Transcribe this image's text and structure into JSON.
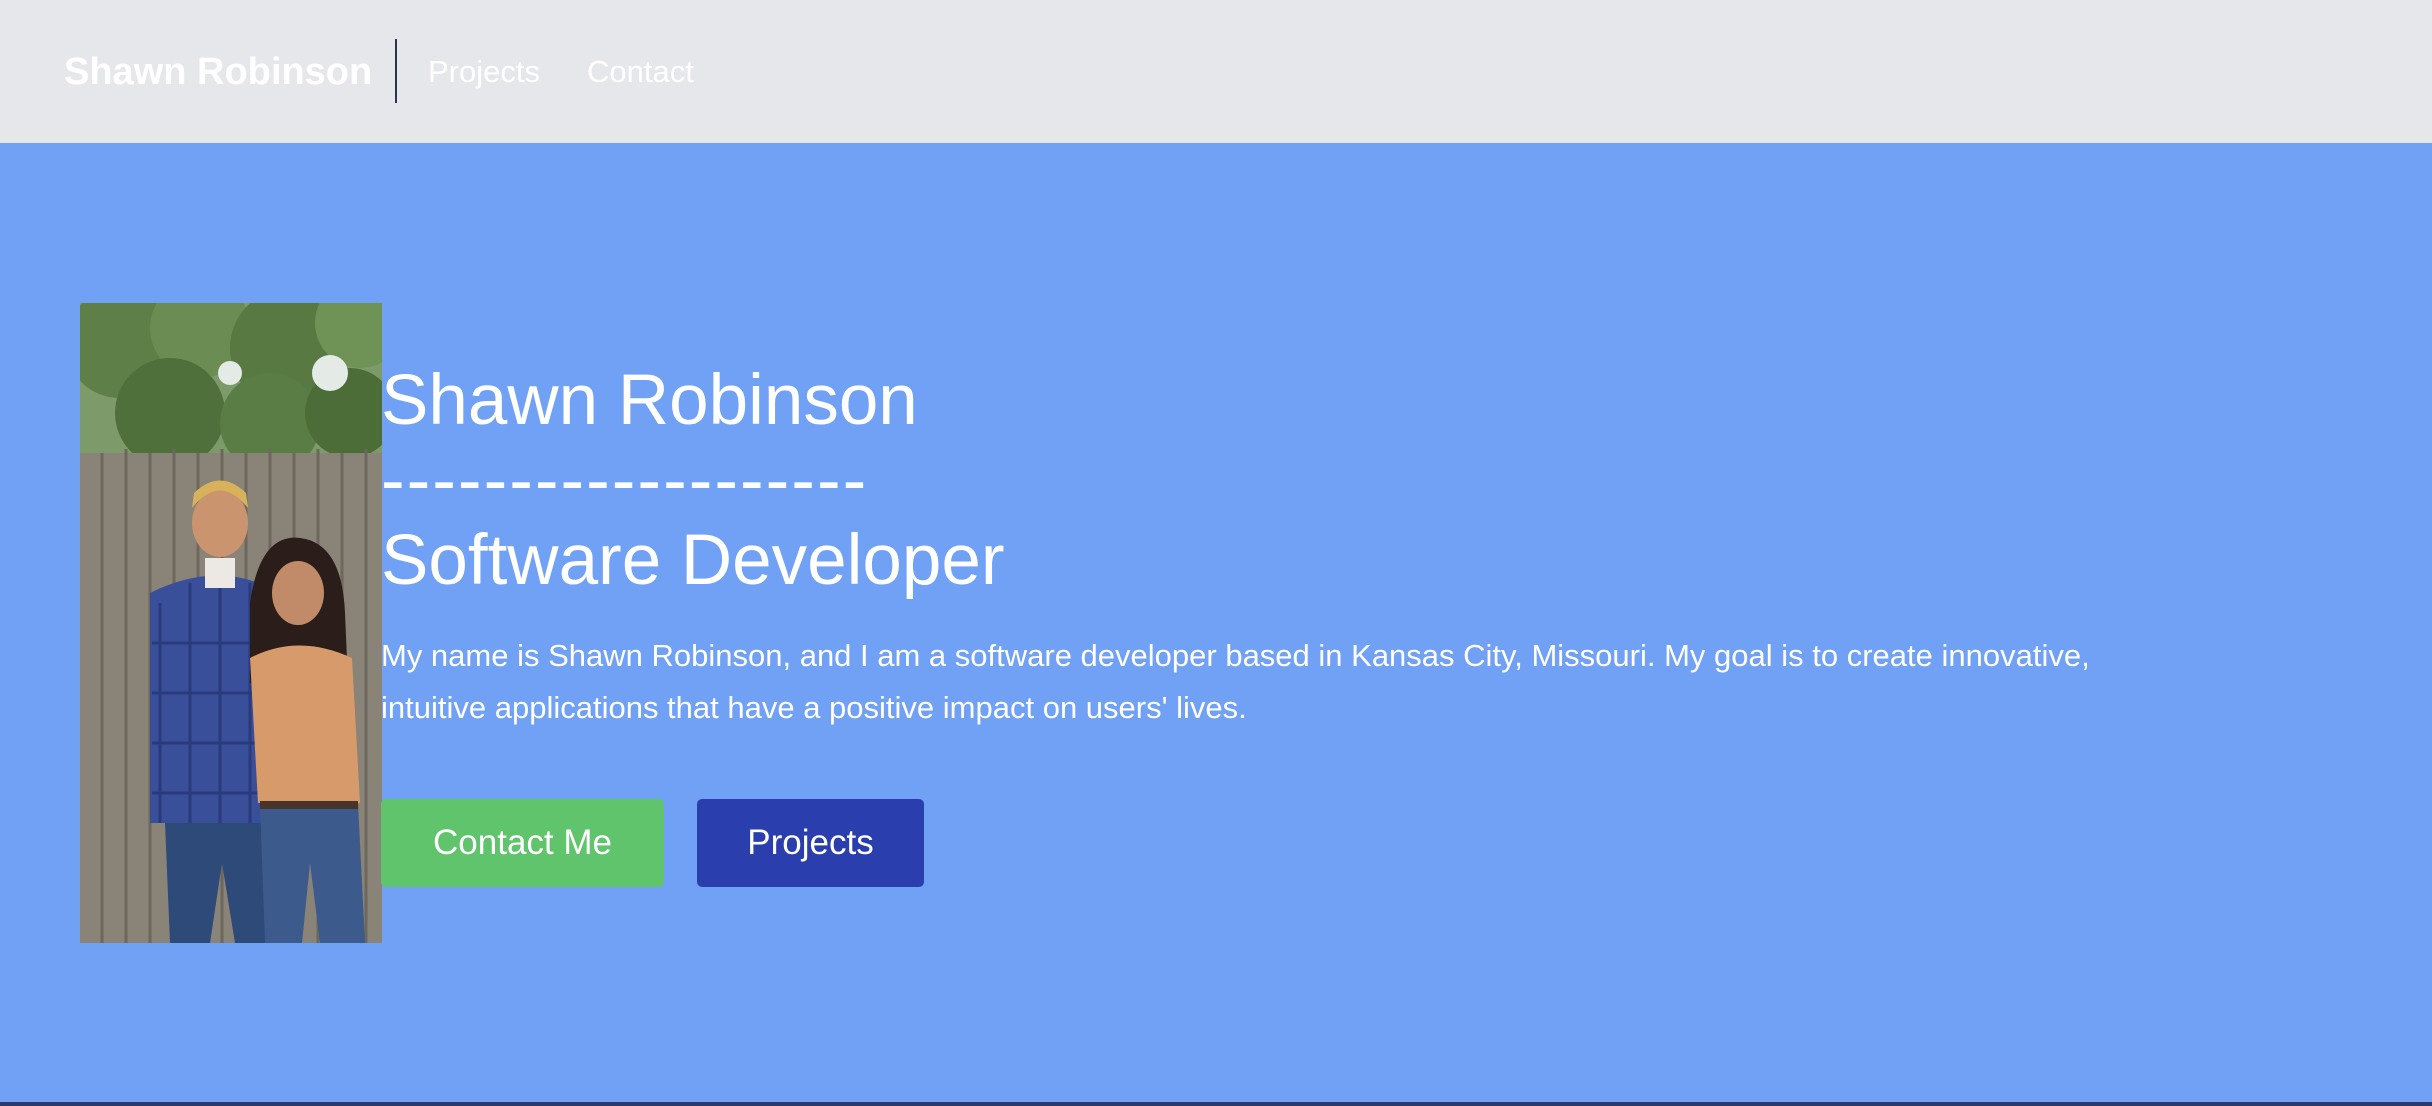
{
  "header": {
    "brand": "Shawn Robinson",
    "nav": [
      {
        "label": "Projects"
      },
      {
        "label": "Contact"
      }
    ]
  },
  "hero": {
    "title": "Shawn Robinson",
    "dashes": "-------------------",
    "subtitle": "Software Developer",
    "description": "My name is Shawn Robinson, and I am a software developer based in Kansas City, Missouri. My goal is to create innovative, intuitive applications that have a positive impact on users' lives.",
    "buttons": {
      "contact_label": "Contact Me",
      "projects_label": "Projects"
    }
  },
  "colors": {
    "header_bg": "#e6e7ea",
    "hero_bg": "#70a1f4",
    "contact_button": "#5fc46c",
    "projects_button": "#2a3fad",
    "text": "#ffffff"
  }
}
